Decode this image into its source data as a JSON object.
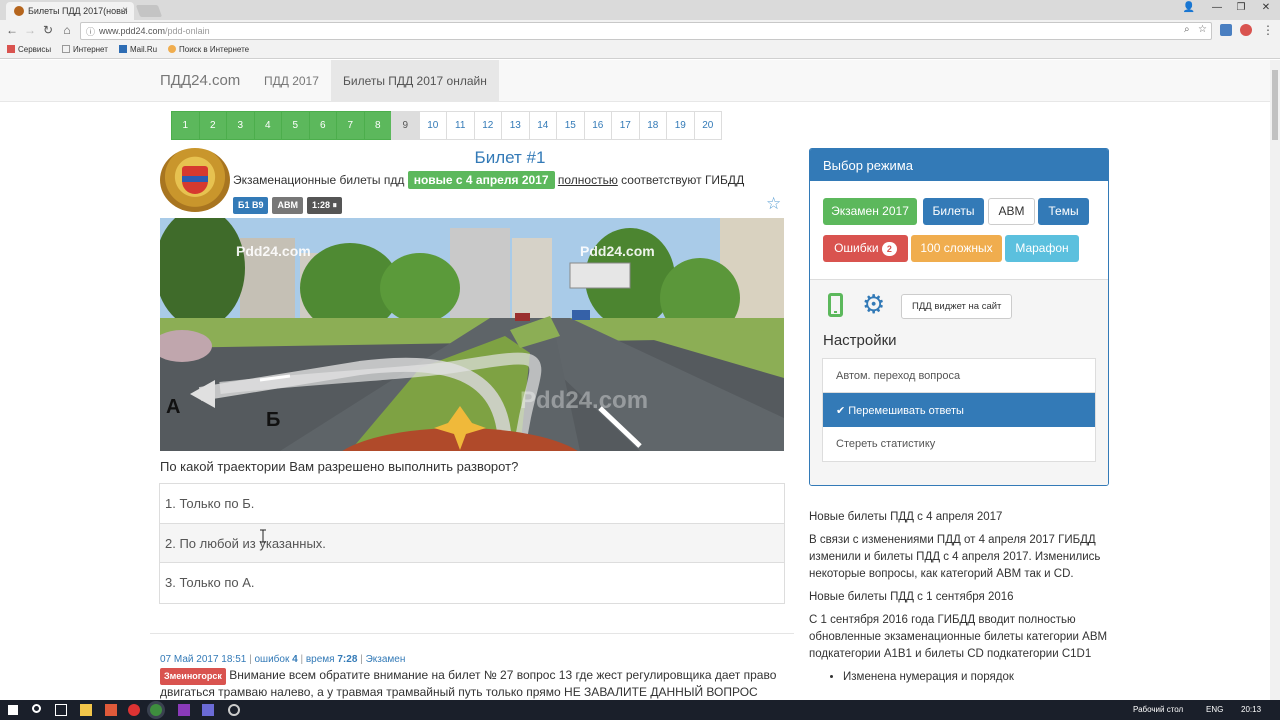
{
  "browser": {
    "tab_title": "Билеты ПДД 2017(новы",
    "tab_close": "×",
    "url_host": "www.pdd24.com",
    "url_path": "/pdd-onlain",
    "bookmarks": [
      "Сервисы",
      "Интернет",
      "Mail.Ru",
      "Поиск в Интернете"
    ]
  },
  "nav": {
    "brand": "ПДД24.com",
    "links": [
      "ПДД 2017",
      "Билеты ПДД 2017 онлайн"
    ]
  },
  "pager": {
    "pages": [
      "1",
      "2",
      "3",
      "4",
      "5",
      "6",
      "7",
      "8",
      "9",
      "10",
      "11",
      "12",
      "13",
      "14",
      "15",
      "16",
      "17",
      "18",
      "19",
      "20"
    ],
    "answered_count": 8,
    "current": "9"
  },
  "ticket": {
    "title": "Билет #1",
    "subtitle_pre": "Экзаменационные билеты пдд",
    "subtitle_highlight": "новые с 4 апреля 2017",
    "subtitle_link": "полностью",
    "subtitle_post": "соответствуют ГИБДД",
    "badges": [
      "Б1 В9",
      "АВМ",
      "1:28 ⏸"
    ],
    "scene_watermarks": [
      "Pdd24.com",
      "Pdd24.com",
      "Pdd24.com"
    ],
    "scene_labels": [
      "А",
      "Б"
    ],
    "question": "По какой траектории Вам разрешено выполнить разворот?",
    "answers": [
      "1. Только по Б.",
      "2. По любой из указанных.",
      "3. Только по А."
    ]
  },
  "comment": {
    "date": "07 Май 2017 18:51",
    "errors_label": "ошибок",
    "errors": "4",
    "time_label": "время",
    "time": "7:28",
    "mode": "Экзамен",
    "city": "Змеиногорск",
    "text": "Внимание всем обратите внимание на билет № 27 вопрос 13 где жест регулировщика дает право двигаться трамваю налево, а у травмая трамвайный путь только прямо НЕ ЗАВАЛИТЕ ДАННЫЙ ВОПРОС"
  },
  "panel": {
    "title": "Выбор режима",
    "modes": {
      "exam": "Экзамен 2017",
      "tickets": "Билеты",
      "abm": "АВМ",
      "topics": "Темы",
      "mistakes": "Ошибки",
      "mistakes_count": "2",
      "hard": "100 сложных",
      "marathon": "Марафон"
    },
    "widget": "ПДД виджет на сайт",
    "settings_title": "Настройки",
    "settings": [
      "Автом. переход вопроса",
      "✔ Перемешивать ответы",
      "Стереть статистику"
    ]
  },
  "news": {
    "items": [
      "Новые билеты ПДД с 4 апреля 2017",
      "В связи с изменениями ПДД от 4 апреля 2017 ГИБДД изменили и билеты ПДД с 4 апреля 2017. Изменились некоторые вопросы, как категорий АВМ так и CD.",
      "Новые билеты ПДД с 1 сентября 2016",
      "С 1 сентября 2016 года ГИБДД вводит полностью обновленные экзаменационные билеты категории АВМ подкатегории А1В1 и билеты CD подкатегории C1D1"
    ],
    "bullet": "Изменена нумерация и порядок"
  },
  "taskbar": {
    "desktop": "Рабочий стол",
    "lang": "ENG",
    "time": "20:13"
  },
  "colors": {
    "primary": "#337ab7",
    "success": "#5cb85c",
    "danger": "#d9534f",
    "warning": "#f0ad4e",
    "info": "#5bc0de"
  }
}
